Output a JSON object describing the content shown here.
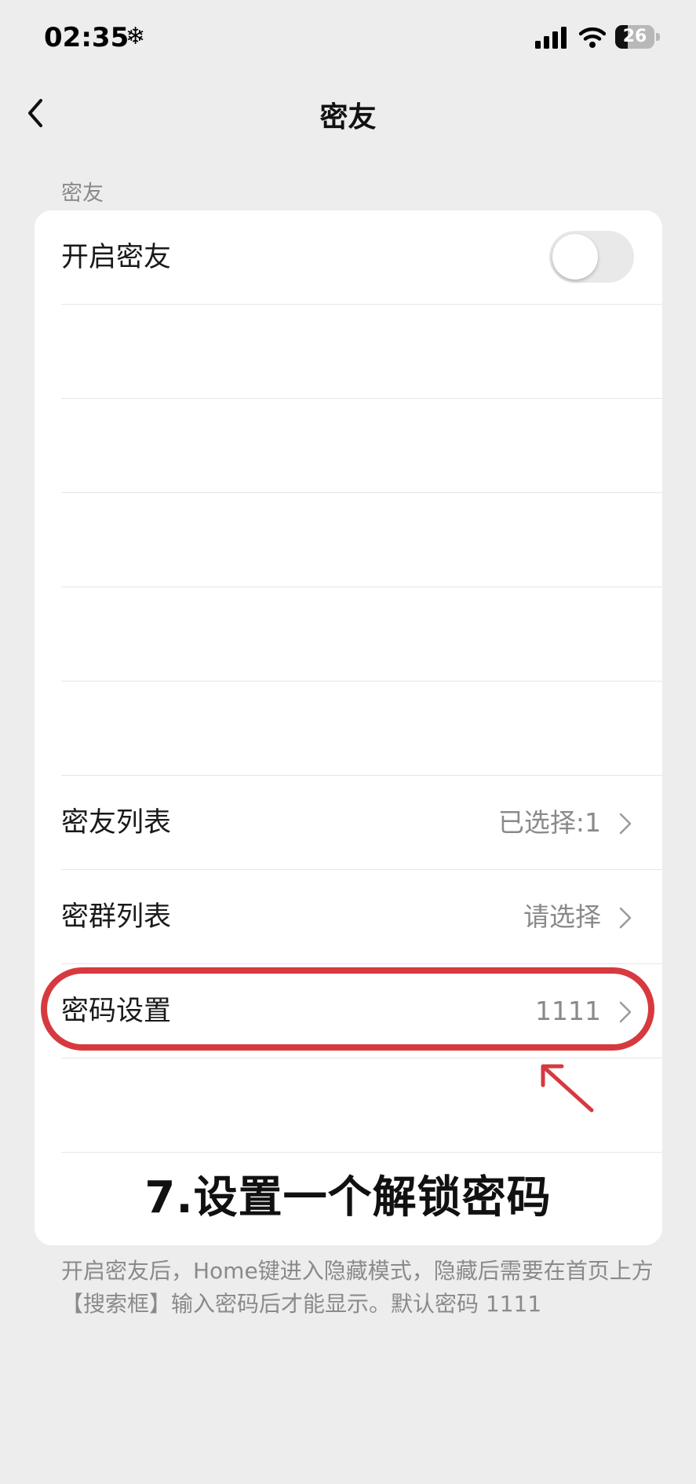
{
  "status_bar": {
    "time": "02:35",
    "snow_glyph": "❄",
    "battery_level": "26"
  },
  "nav": {
    "title": "密友"
  },
  "section": {
    "label": "密友"
  },
  "rows": {
    "enable": {
      "label": "开启密友",
      "toggle_on": false
    },
    "friends_list": {
      "label": "密友列表",
      "value": "已选择:1"
    },
    "groups_list": {
      "label": "密群列表",
      "value": "请选择"
    },
    "password": {
      "label": "密码设置",
      "value": "1111"
    }
  },
  "annotation": {
    "text": "7.设置一个解锁密码",
    "color": "#d63a3f"
  },
  "footer": {
    "note": "开启密友后，Home键进入隐藏模式，隐藏后需要在首页上方【搜索框】输入密码后才能显示。默认密码 1111"
  }
}
